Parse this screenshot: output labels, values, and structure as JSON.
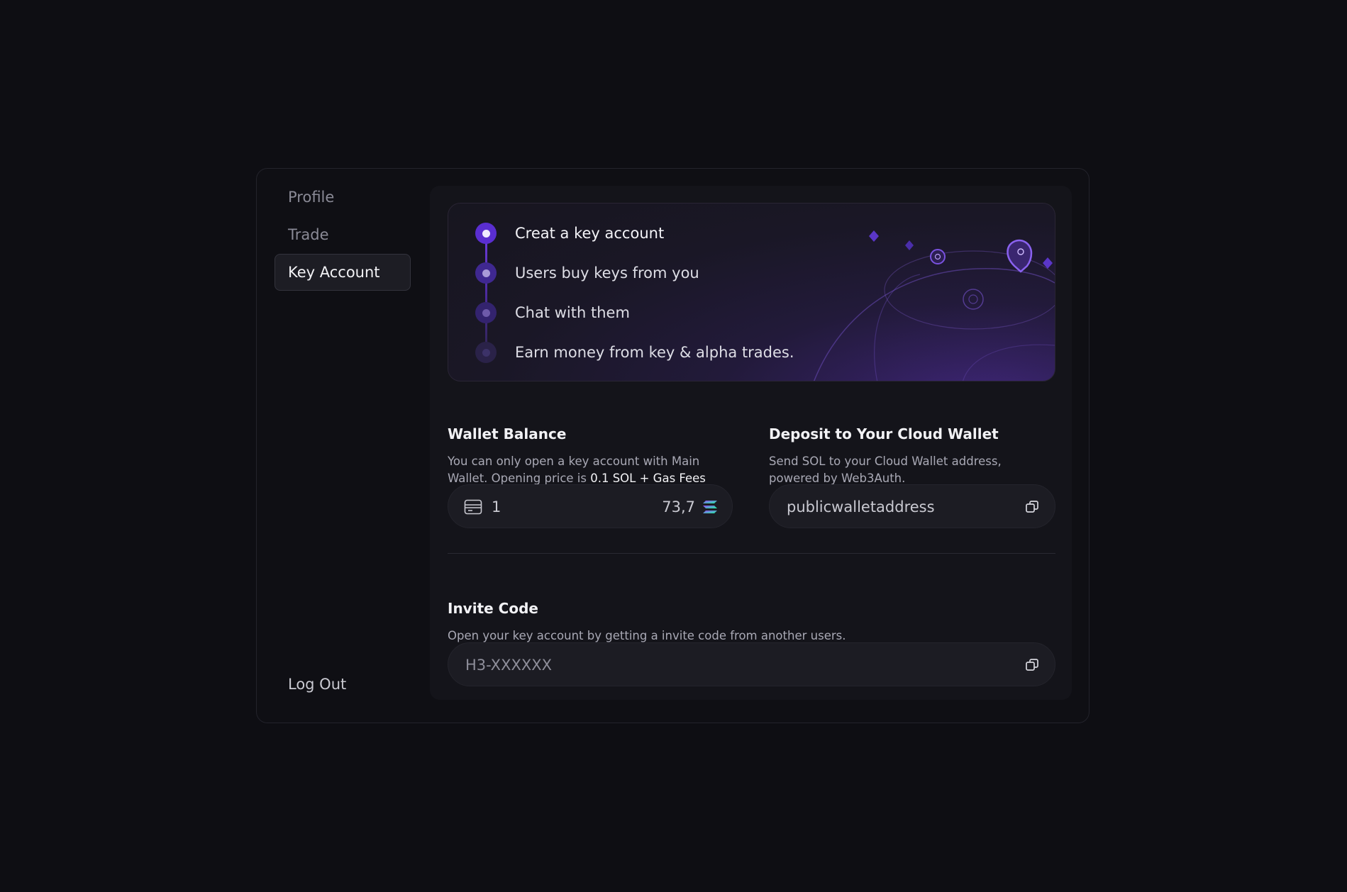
{
  "sidebar": {
    "items": [
      {
        "label": "Profile",
        "active": false
      },
      {
        "label": "Trade",
        "active": false
      },
      {
        "label": "Key Account",
        "active": true
      }
    ],
    "logout_label": "Log Out"
  },
  "steps": [
    {
      "label": "Creat a key account",
      "state": "active"
    },
    {
      "label": "Users buy keys from you",
      "state": "pending"
    },
    {
      "label": "Chat with them",
      "state": "pending"
    },
    {
      "label": "Earn money from key & alpha trades.",
      "state": "pending"
    }
  ],
  "wallet": {
    "title": "Wallet Balance",
    "desc_prefix": "You can only open a key account with Main Wallet. Opening price is ",
    "desc_highlight": "0.1 SOL + Gas Fees",
    "count": "1",
    "balance": "73,7",
    "icons": {
      "wallet": "wallet-icon",
      "token": "solana-icon"
    }
  },
  "deposit": {
    "title": "Deposit to Your Cloud Wallet",
    "desc": "Send SOL to your Cloud Wallet address, powered by Web3Auth.",
    "address": "publicwalletaddress",
    "icon": "copy-icon"
  },
  "invite": {
    "title": "Invite Code",
    "desc": "Open your key account by getting a invite code from another users.",
    "code": "H3-XXXXXX",
    "icon": "copy-icon"
  },
  "colors": {
    "accent": "#6a3ad8",
    "background": "#0e0e13",
    "panel": "#14141a"
  }
}
